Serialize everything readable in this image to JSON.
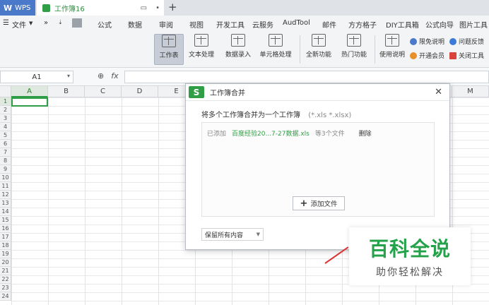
{
  "titlebar": {
    "app_tab": "WPS",
    "doc_tab": "工作簿16"
  },
  "menubar": {
    "file": "文件",
    "items": [
      "公式",
      "数据",
      "审阅",
      "视图",
      "开发工具",
      "云服务",
      "AudTool",
      "邮件",
      "方方格子",
      "DIY工具箱",
      "公式向导",
      "图片工具"
    ]
  },
  "ribbon": {
    "buttons": [
      "工作表",
      "文本处理",
      "数据录入",
      "单元格处理",
      "全新功能",
      "热门功能",
      "使用说明"
    ],
    "side_right": [
      "限免说明",
      "问题反馈",
      "开通会员",
      "关闭工具"
    ]
  },
  "formula_bar": {
    "name_box": "A1",
    "fx_label": "fx"
  },
  "grid": {
    "columns": [
      "A",
      "B",
      "C",
      "D",
      "E",
      "M"
    ],
    "rows": [
      "1",
      "2",
      "3",
      "4",
      "5",
      "6",
      "7",
      "8",
      "9",
      "10",
      "11",
      "12",
      "13",
      "14",
      "15",
      "16",
      "17",
      "18",
      "19",
      "20",
      "21",
      "22",
      "23",
      "24"
    ]
  },
  "dialog": {
    "title": "工作簿合并",
    "description": "将多个工作簿合并为一个工作簿",
    "extensions": "(*.xls *.xlsx)",
    "file_status": "已添加",
    "file_name": "百度经验20...7-27数据.xls",
    "file_count": "等3个文件",
    "delete_label": "删除",
    "add_button": "添加文件",
    "keep_select": "保留所有内容"
  },
  "watermark": {
    "title": "百科全说",
    "subtitle": "助你轻松解决"
  }
}
